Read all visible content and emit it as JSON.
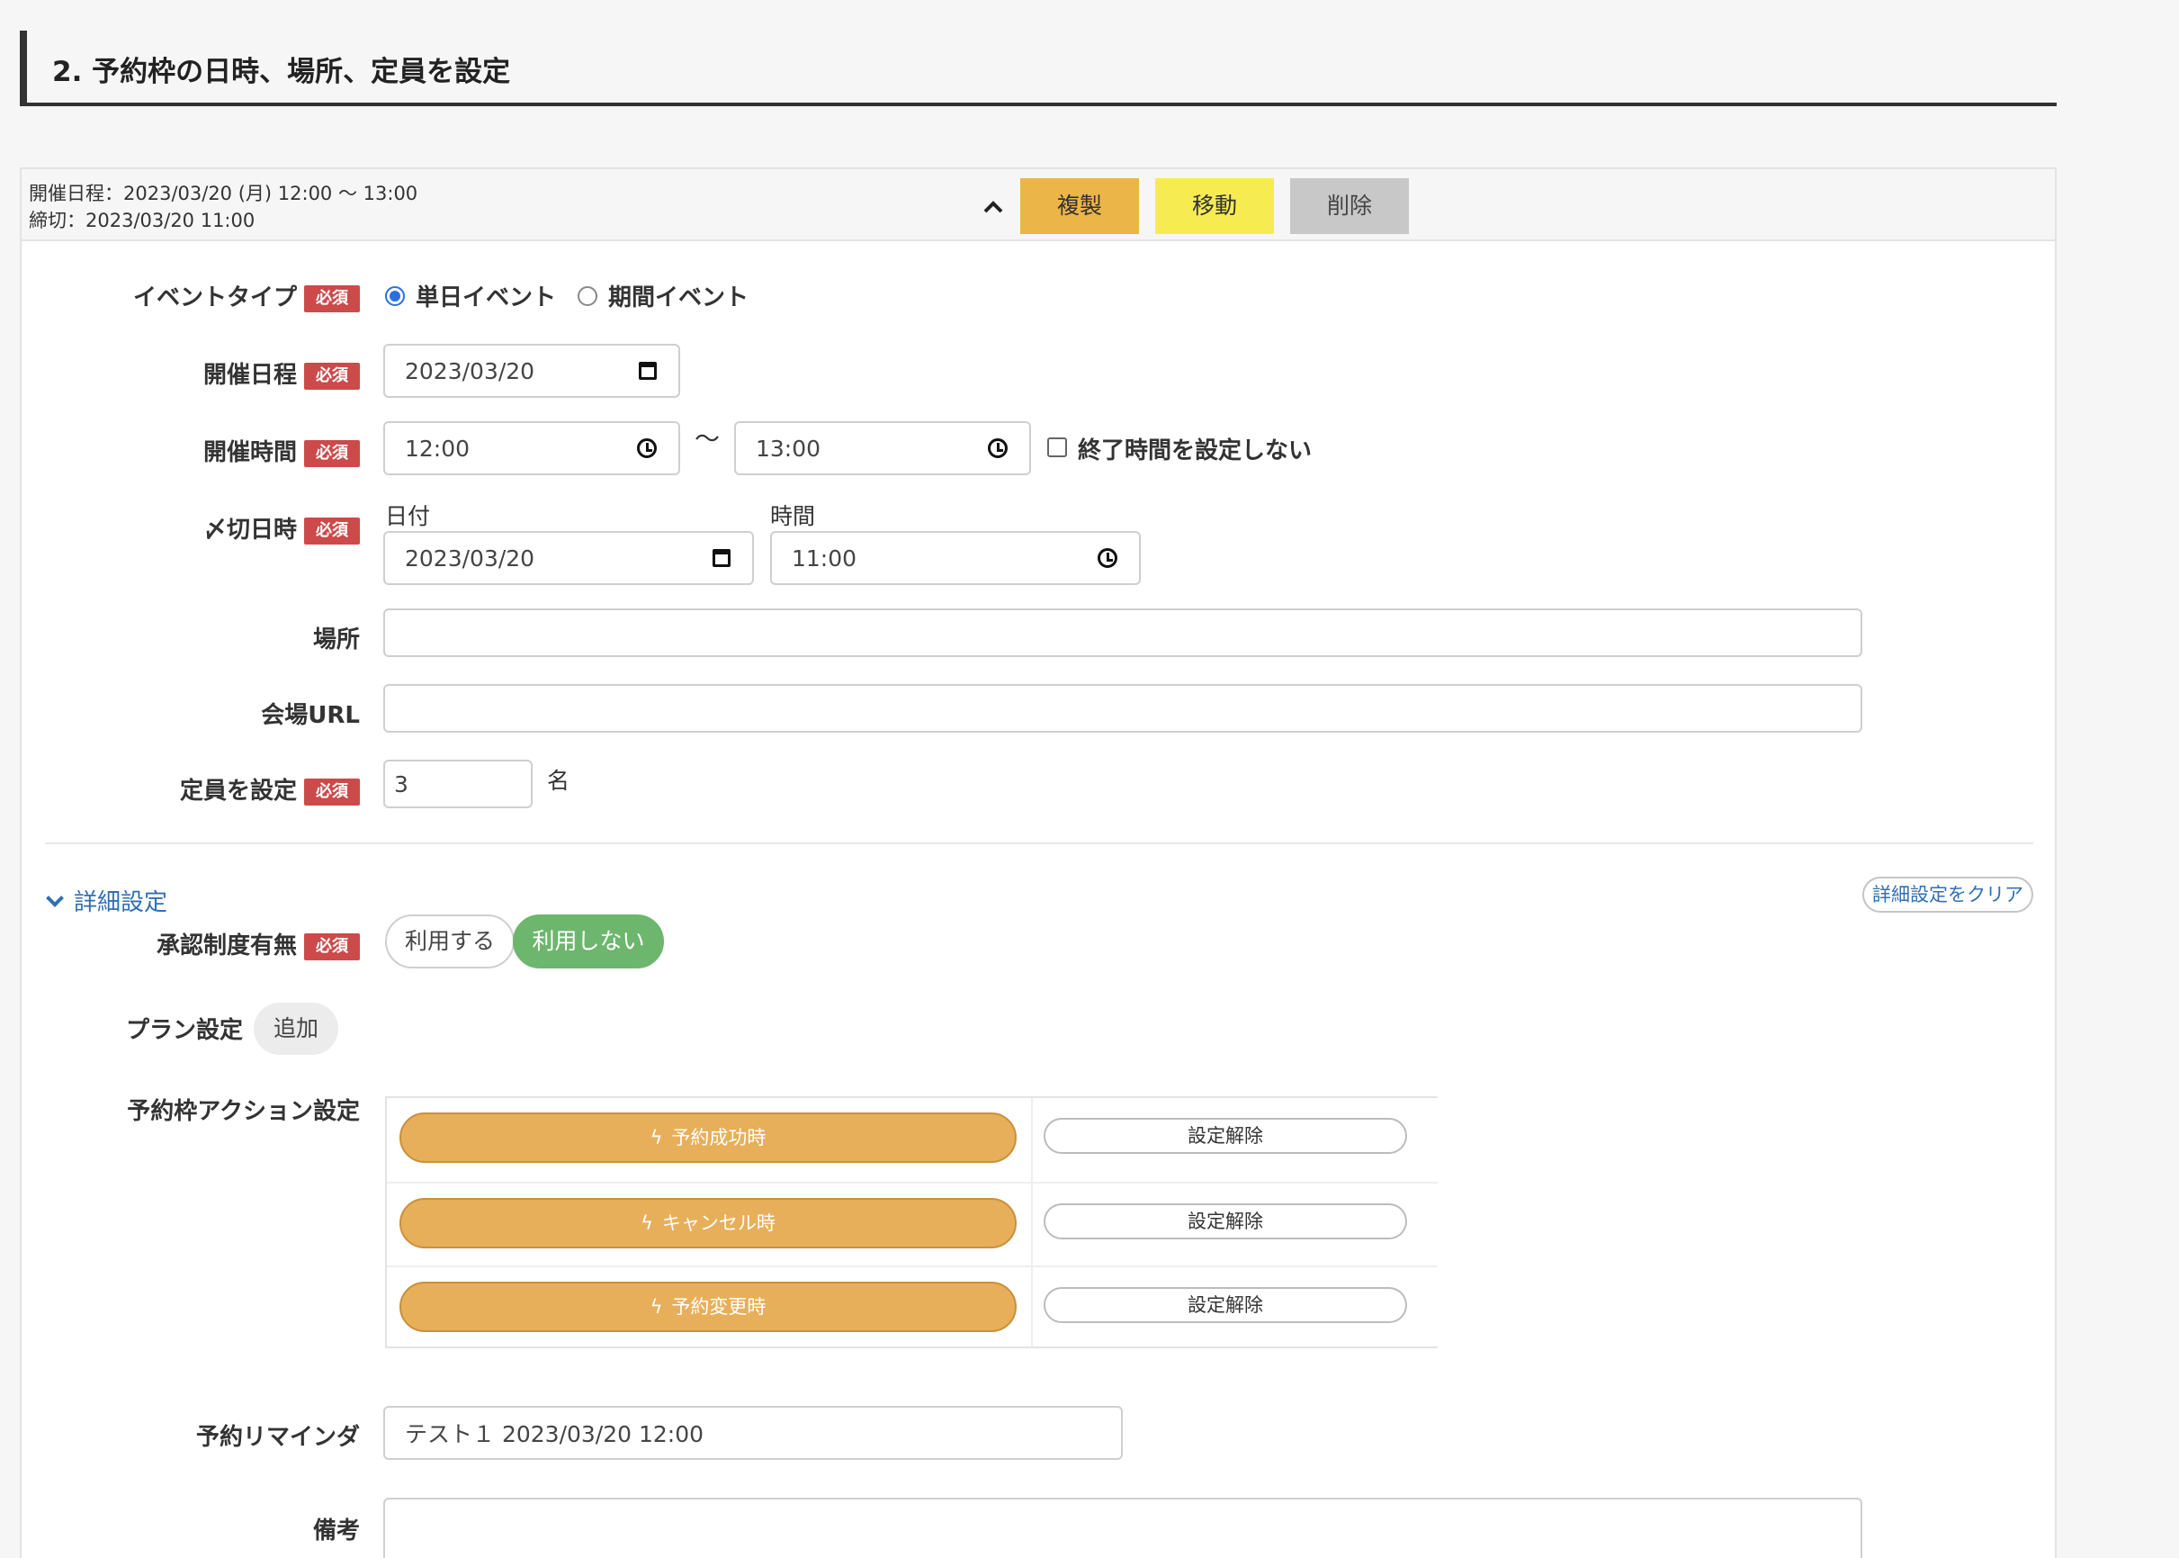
{
  "section": {
    "title": "2. 予約枠の日時、場所、定員を設定"
  },
  "summary": {
    "line1": "開催日程：2023/03/20 (月) 12:00 〜 13:00",
    "line2": "締切：2023/03/20 11:00"
  },
  "header_buttons": {
    "collapse": "⌃",
    "duplicate": "複製",
    "move": "移動",
    "delete": "削除"
  },
  "required_badge": "必須",
  "event_type": {
    "label": "イベントタイプ",
    "options": [
      "単日イベント",
      "期間イベント"
    ],
    "selected": "単日イベント"
  },
  "event_date": {
    "label": "開催日程",
    "value": "2023/03/20"
  },
  "event_time": {
    "label": "開催時間",
    "start": "12:00",
    "separator": "〜",
    "end": "13:00",
    "no_end_label": "終了時間を設定しない"
  },
  "deadline": {
    "label": "〆切日時",
    "date_label": "日付",
    "date_value": "2023/03/20",
    "time_label": "時間",
    "time_value": "11:00"
  },
  "location": {
    "label": "場所",
    "value": ""
  },
  "venue_url": {
    "label": "会場URL",
    "value": ""
  },
  "capacity": {
    "label": "定員を設定",
    "value": "3",
    "unit": "名"
  },
  "advanced": {
    "toggle_label": "詳細設定",
    "clear_label": "詳細設定をクリア"
  },
  "approval": {
    "label": "承認制度有無",
    "options": [
      "利用する",
      "利用しない"
    ],
    "selected": "利用しない"
  },
  "plan": {
    "label": "プラン設定",
    "add_label": "追加"
  },
  "actions": {
    "label": "予約枠アクション設定",
    "rows": [
      {
        "trigger": "予約成功時",
        "unset": "設定解除"
      },
      {
        "trigger": "キャンセル時",
        "unset": "設定解除"
      },
      {
        "trigger": "予約変更時",
        "unset": "設定解除"
      }
    ]
  },
  "reminder": {
    "label": "予約リマインダ",
    "value": "テスト１ 2023/03/20 12:00"
  },
  "notes": {
    "label": "備考",
    "value": ""
  }
}
